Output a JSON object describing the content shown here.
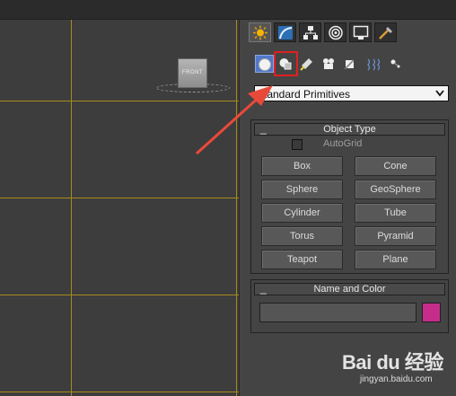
{
  "viewport": {
    "viewcube_label": "FRONT"
  },
  "command_panel": {
    "tabs": [
      {
        "icon": "create-icon",
        "active": true
      },
      {
        "icon": "modify-icon",
        "active": false
      },
      {
        "icon": "hierarchy-icon",
        "active": false
      },
      {
        "icon": "motion-icon",
        "active": false
      },
      {
        "icon": "display-icon",
        "active": false
      },
      {
        "icon": "utilities-icon",
        "active": false
      }
    ],
    "subcategories": [
      {
        "icon": "geometry-icon",
        "selected": true
      },
      {
        "icon": "shapes-icon",
        "selected": false,
        "highlighted": true
      },
      {
        "icon": "lights-icon",
        "selected": false
      },
      {
        "icon": "cameras-icon",
        "selected": false
      },
      {
        "icon": "helpers-icon",
        "selected": false
      },
      {
        "icon": "space-warps-icon",
        "selected": false
      },
      {
        "icon": "systems-icon",
        "selected": false
      }
    ],
    "dropdown": {
      "value": "Standard Primitives"
    },
    "object_type": {
      "title": "Object Type",
      "collapse_symbol": "_",
      "autogrid_label": "AutoGrid",
      "autogrid_checked": false,
      "buttons": [
        "Box",
        "Cone",
        "Sphere",
        "GeoSphere",
        "Cylinder",
        "Tube",
        "Torus",
        "Pyramid",
        "Teapot",
        "Plane"
      ]
    },
    "name_and_color": {
      "title": "Name and Color",
      "collapse_symbol": "_",
      "name_value": "",
      "swatch_color": "#c62d8b"
    }
  },
  "colors": {
    "grid_line": "#a88a1c",
    "selection": "#5378c9",
    "highlight_box": "#e02020",
    "annotation_arrow": "#e84a3a"
  },
  "watermark": {
    "logo": "Bai du 经验",
    "url": "jingyan.baidu.com"
  }
}
